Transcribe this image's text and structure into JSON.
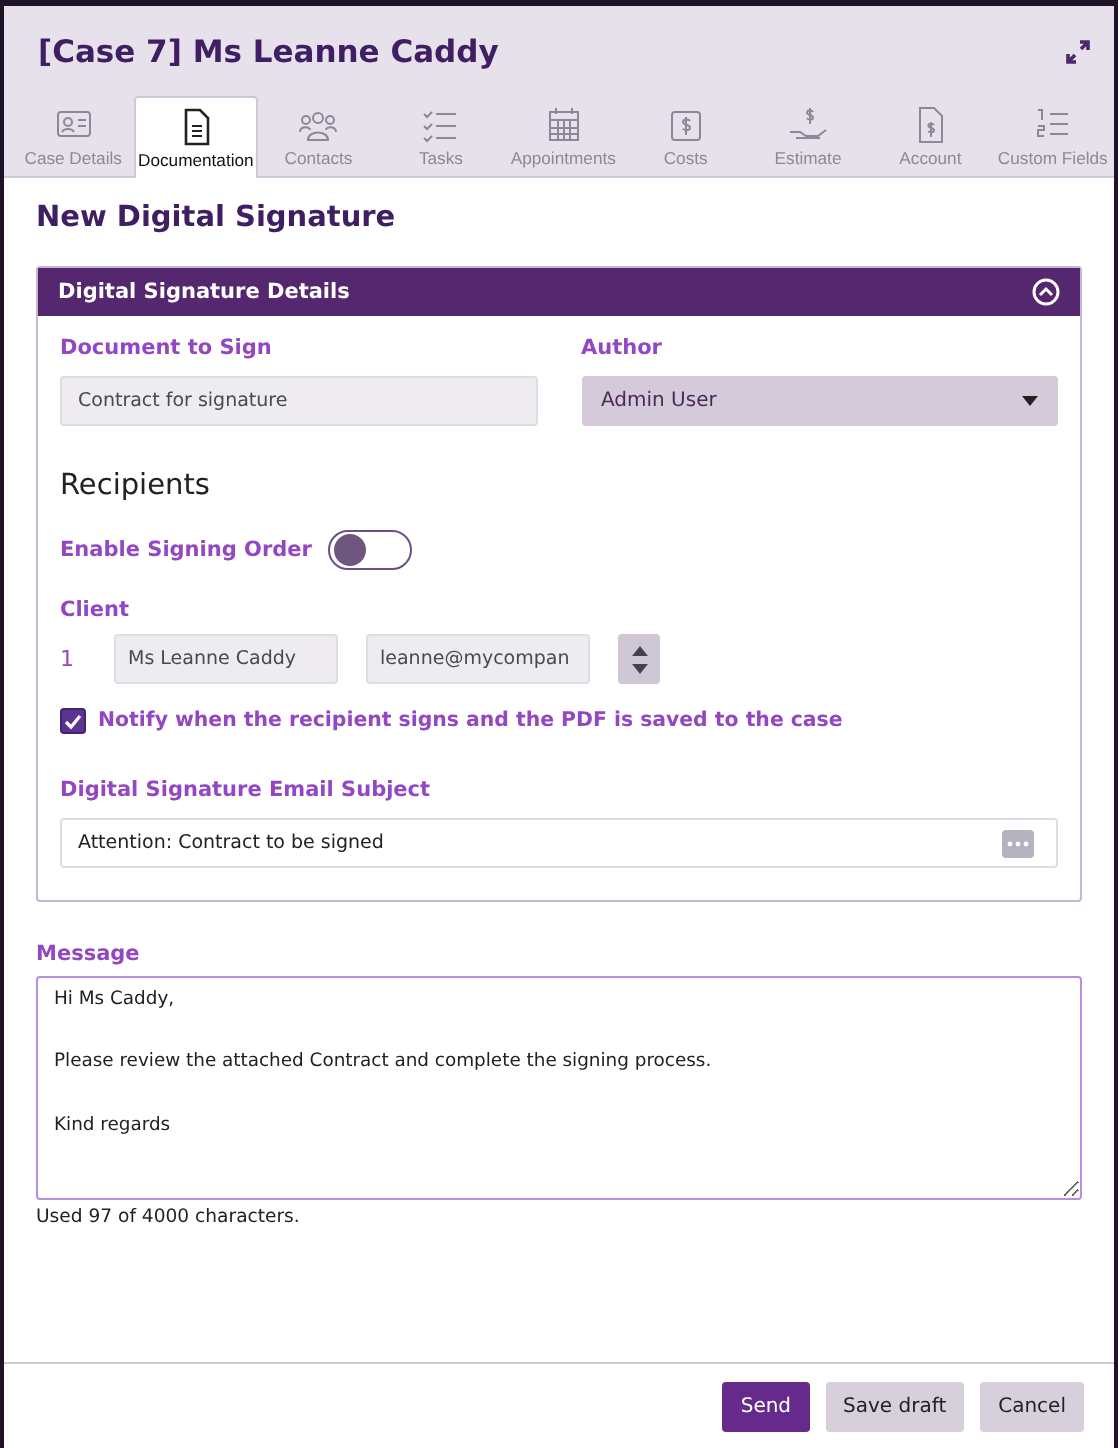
{
  "window": {
    "title": "[Case 7] Ms Leanne Caddy"
  },
  "tabs": [
    {
      "label": "Case Details",
      "selected": false
    },
    {
      "label": "Documentation",
      "selected": true
    },
    {
      "label": "Contacts",
      "selected": false
    },
    {
      "label": "Tasks",
      "selected": false
    },
    {
      "label": "Appointments",
      "selected": false
    },
    {
      "label": "Costs",
      "selected": false
    },
    {
      "label": "Estimate",
      "selected": false
    },
    {
      "label": "Account",
      "selected": false
    },
    {
      "label": "Custom Fields",
      "selected": false
    }
  ],
  "page_title": "New Digital Signature",
  "panel": {
    "title": "Digital Signature Details",
    "expanded": true,
    "document": {
      "label": "Document to Sign",
      "value": "Contract for signature"
    },
    "author": {
      "label": "Author",
      "value": "Admin User"
    },
    "recipients_heading": "Recipients",
    "signing_order": {
      "label": "Enable Signing Order",
      "on": false
    },
    "client": {
      "label": "Client",
      "number": "1",
      "name": "Ms Leanne Caddy",
      "email": "leanne@mycompan"
    },
    "notify": {
      "label": "Notify when the recipient signs and the PDF is saved to the case",
      "checked": true
    },
    "subject": {
      "label": "Digital Signature Email Subject",
      "value": "Attention: Contract to be signed"
    }
  },
  "message": {
    "label": "Message",
    "value": "Hi Ms Caddy,\n\nPlease review the attached Contract and complete the signing process.\n\nKind regards",
    "counter": "Used 97 of 4000 characters."
  },
  "buttons": [
    {
      "label": "Send",
      "kind": "primary"
    },
    {
      "label": "Save draft",
      "kind": "secondary"
    },
    {
      "label": "Cancel",
      "kind": "secondary"
    }
  ]
}
